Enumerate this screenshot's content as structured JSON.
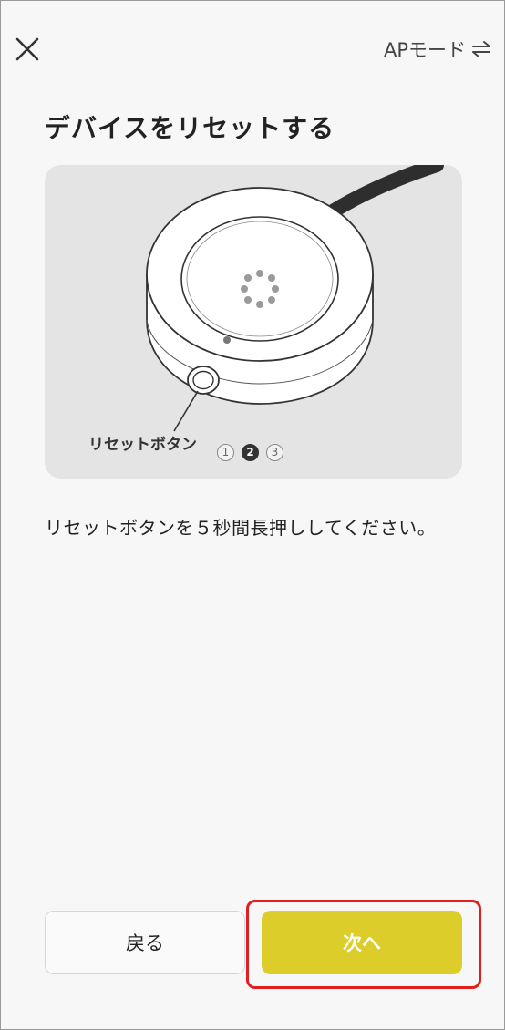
{
  "header": {
    "ap_mode_label": "APモード",
    "close_icon": "close-icon",
    "switch_icon": "swap-arrows-icon"
  },
  "title": "デバイスをリセットする",
  "illustration": {
    "reset_label": "リセットボタン",
    "pager": [
      "1",
      "2",
      "3"
    ],
    "current_page": 2
  },
  "instruction": "リセットボタンを５秒間長押ししてください。",
  "buttons": {
    "back_label": "戻る",
    "next_label": "次へ"
  },
  "colors": {
    "accent": "#dccd2a",
    "highlight": "#e02020",
    "background": "#f7f7f7"
  }
}
